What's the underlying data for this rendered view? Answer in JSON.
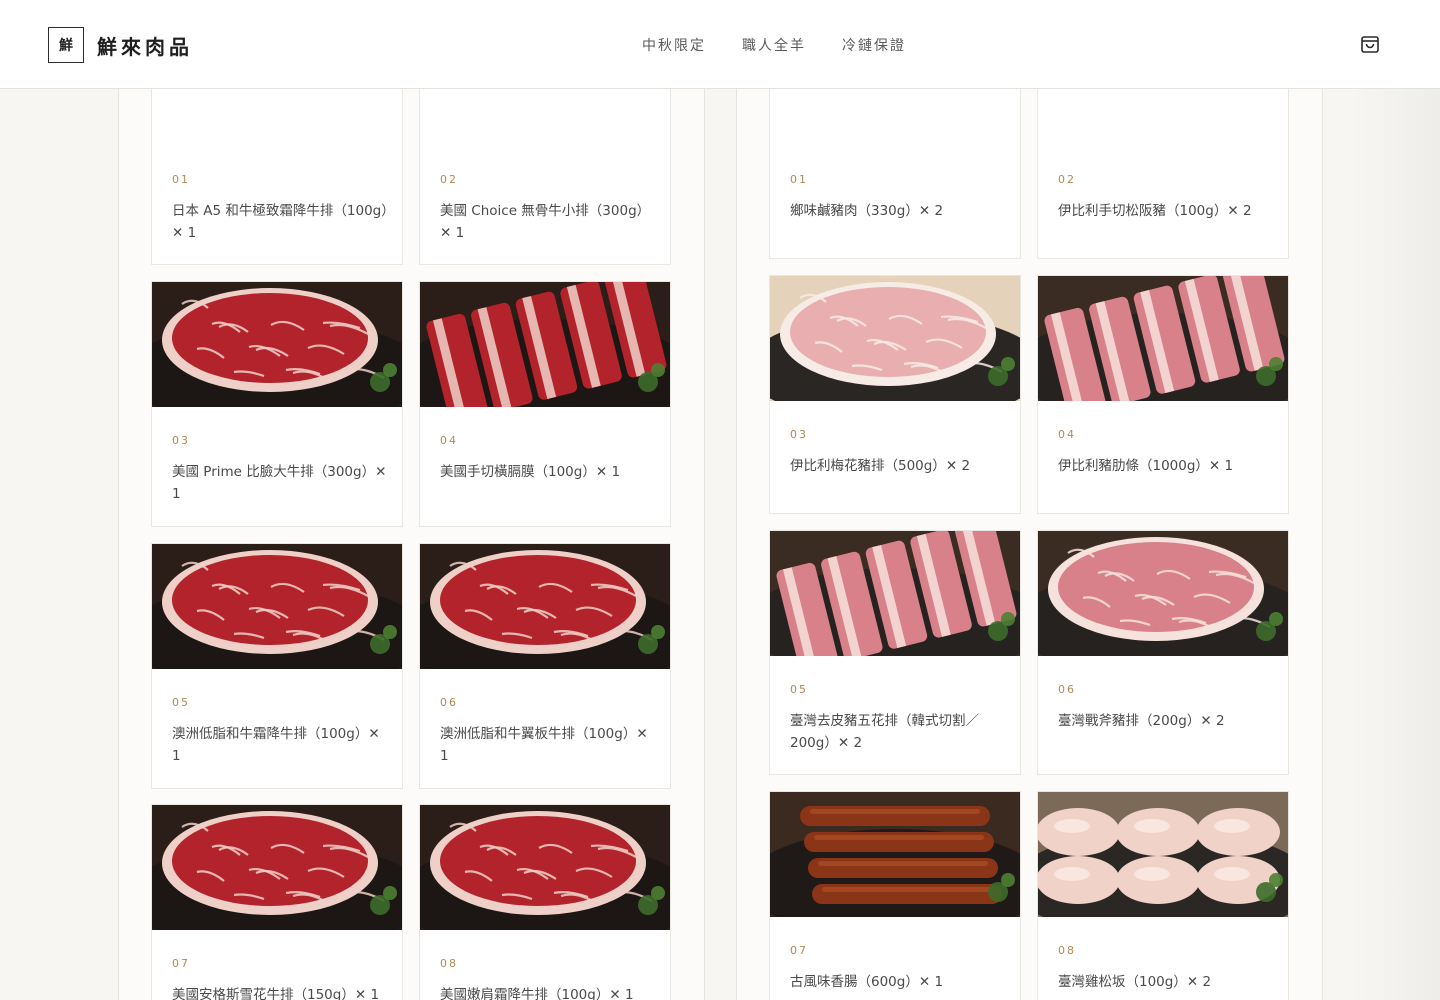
{
  "header": {
    "logo_char": "鮮",
    "brand_name": "鮮來肉品",
    "nav": [
      "中秋限定",
      "職人全羊",
      "冷鏈保證"
    ],
    "cart_icon": "shopping-bag-icon"
  },
  "left_column": {
    "items": [
      {
        "num": "01",
        "name": "日本 A5 和牛極致霜降牛排（100g）✕ 1",
        "image": "steak-photo"
      },
      {
        "num": "02",
        "name": "美國 Choice 無骨牛小排（300g）✕ 1",
        "image": "short-rib-photo"
      },
      {
        "num": "03",
        "name": "美國 Prime 比臉大牛排（300g）✕ 1",
        "image": "steak-photo"
      },
      {
        "num": "04",
        "name": "美國手切橫膈膜（100g）✕ 1",
        "image": "skirt-steak-photo"
      },
      {
        "num": "05",
        "name": "澳洲低脂和牛霜降牛排（100g）✕ 1",
        "image": "steak-photo"
      },
      {
        "num": "06",
        "name": "澳洲低脂和牛翼板牛排（100g）✕ 1",
        "image": "steak-photo"
      },
      {
        "num": "07",
        "name": "美國安格斯雪花牛排（150g）✕ 1",
        "image": "steak-photo"
      },
      {
        "num": "08",
        "name": "美國嫩肩霜降牛排（100g）✕ 1",
        "image": "steak-photo"
      }
    ]
  },
  "right_column": {
    "items": [
      {
        "num": "01",
        "name": "鄉味鹹豬肉（330g）✕ 2",
        "image": "salted-pork-photo"
      },
      {
        "num": "02",
        "name": "伊比利手切松阪豬（100g）✕ 2",
        "image": "pork-jowl-photo"
      },
      {
        "num": "03",
        "name": "伊比利梅花豬排（500g）✕ 2",
        "image": "pork-shoulder-photo"
      },
      {
        "num": "04",
        "name": "伊比利豬肋條（1000g）✕ 1",
        "image": "pork-rib-photo"
      },
      {
        "num": "05",
        "name": "臺灣去皮豬五花排（韓式切割／200g）✕ 2",
        "image": "pork-belly-photo"
      },
      {
        "num": "06",
        "name": "臺灣戰斧豬排（200g）✕ 2",
        "image": "tomahawk-pork-photo"
      },
      {
        "num": "07",
        "name": "古風味香腸（600g）✕ 1",
        "image": "sausage-photo"
      },
      {
        "num": "08",
        "name": "臺灣雞松坂（100g）✕ 2",
        "image": "chicken-photo"
      }
    ]
  }
}
